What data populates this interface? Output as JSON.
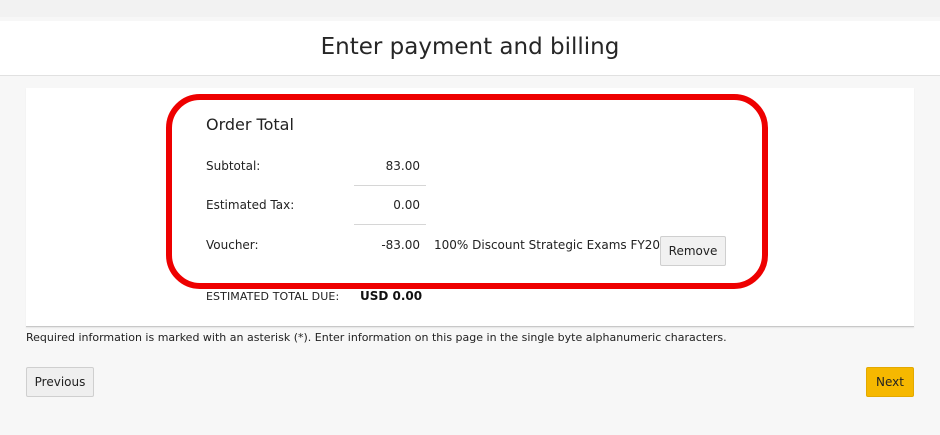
{
  "page": {
    "title": "Enter payment and billing"
  },
  "order_total": {
    "heading": "Order Total",
    "rows": [
      {
        "label": "Subtotal:",
        "value": "83.00"
      },
      {
        "label": "Estimated Tax:",
        "value": "0.00"
      },
      {
        "label": "Voucher:",
        "value": "-83.00"
      }
    ],
    "voucher_description": "100% Discount Strategic Exams FY20",
    "remove_label": "Remove",
    "total_label": "ESTIMATED TOTAL DUE:",
    "total_value": "USD 0.00"
  },
  "note": "Required information is marked with an asterisk (*). Enter information on this page in the single byte alphanumeric characters.",
  "nav": {
    "previous_label": "Previous",
    "next_label": "Next"
  },
  "colors": {
    "highlight": "#ee0000",
    "next_button": "#f6b800"
  }
}
